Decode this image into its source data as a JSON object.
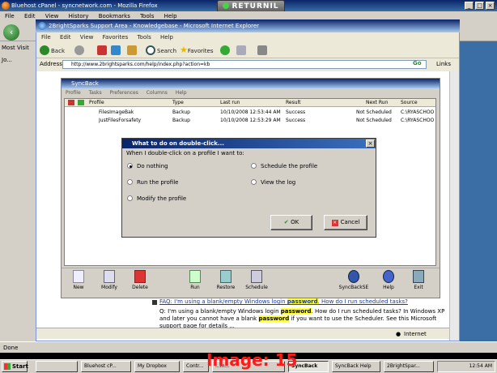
{
  "firefox": {
    "title": "Bluehost cPanel - syncnetwork.com - Mozilla Firefox",
    "menu": [
      "File",
      "Edit",
      "View",
      "History",
      "Bookmarks",
      "Tools",
      "Help"
    ],
    "sidebar_items": [
      "Most Visit",
      "Jo..."
    ],
    "status": "Done"
  },
  "returnil": {
    "label": "RETURNIL"
  },
  "ie": {
    "title": "2BrightSparks Support Area - Knowledgebase - Microsoft Internet Explorer",
    "menu": [
      "File",
      "Edit",
      "View",
      "Favorites",
      "Tools",
      "Help"
    ],
    "toolbar": {
      "back": "Back",
      "search": "Search",
      "favorites": "Favorites"
    },
    "address_label": "Address",
    "address": "http://www.2brightsparks.com/help/index.php?action=kb",
    "go": "Go",
    "links": "Links",
    "status_zone": "Internet"
  },
  "syncback": {
    "title": "SyncBack",
    "menu": [
      "Profile",
      "Tasks",
      "Preferences",
      "Columns",
      "Help"
    ],
    "columns": [
      "Profile",
      "Type",
      "Last run",
      "Result",
      "Next Run",
      "Source"
    ],
    "rows": [
      {
        "profile": "FilesImageBak",
        "type": "Backup",
        "last_run": "10/10/2008 12:53:44 AM",
        "result": "Success",
        "next_run": "Not Scheduled",
        "source": "C:\\RYASCHOO"
      },
      {
        "profile": "JustFilesForsafety",
        "type": "Backup",
        "last_run": "10/10/2008 12:53:29 AM",
        "result": "Success",
        "next_run": "Not Scheduled",
        "source": "C:\\RYASCHOO"
      }
    ],
    "toolbar": [
      "New",
      "Modify",
      "Delete",
      "Run",
      "Restore",
      "Schedule",
      "SyncBackSE",
      "Help",
      "Exit"
    ]
  },
  "dialog": {
    "title": "What to do on double-click...",
    "question": "When I double-click on a profile I want to:",
    "options": [
      {
        "label": "Do nothing",
        "selected": true
      },
      {
        "label": "Schedule the profile",
        "selected": false
      },
      {
        "label": "Run the profile",
        "selected": false
      },
      {
        "label": "View the log",
        "selected": false
      },
      {
        "label": "Modify the profile",
        "selected": false
      }
    ],
    "ok": "OK",
    "cancel": "Cancel"
  },
  "faq": {
    "question_pre": "FAQ: I'm using a blank/empty Windows login ",
    "question_hl": "password",
    "question_post": ". How do I run scheduled tasks?",
    "answer_1": "Q: I'm using a blank/empty Windows login ",
    "answer_hl1": "password",
    "answer_2": ". How do I run scheduled tasks? In Windows XP and later you cannot have a blank ",
    "answer_hl2": "password",
    "answer_3": " if you want to use the Scheduler. See this Microsoft support page for details ..."
  },
  "taskbar": {
    "start": "Start",
    "tasks": [
      "",
      "Bluehost cP...",
      "My Dropbox",
      "Contr...",
      "...m...",
      "SyncBack",
      "SyncBack Help",
      "2BrightSpar..."
    ],
    "clock": "12:54 AM"
  },
  "overlay_label": "Image: 15",
  "colors": {
    "titlebar": "#0a246a",
    "highlight": "#ffff33",
    "overlay": "#ff1a1a"
  }
}
